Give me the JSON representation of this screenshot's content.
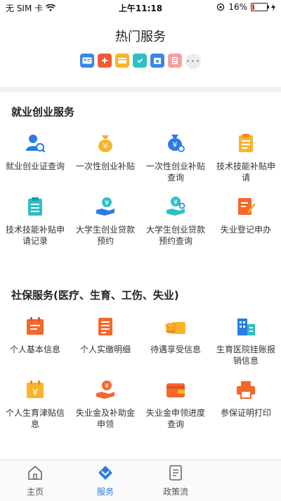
{
  "status_bar": {
    "carrier": "无 SIM 卡",
    "time": "上午11:18",
    "battery": "16%",
    "battery_level": 0.16
  },
  "header": {
    "title": "热门服务"
  },
  "hot_icons": [
    "id-card-icon",
    "medical-kit-icon",
    "wallet-icon",
    "shield-check-icon",
    "calendar-icon",
    "document-icon"
  ],
  "section1": {
    "title": "就业创业服务",
    "items": [
      {
        "label": "就业创业证查询",
        "icon": "user-search-icon"
      },
      {
        "label": "一次性创业补贴",
        "icon": "money-bag-icon"
      },
      {
        "label": "一次性创业补贴查询",
        "icon": "money-bag-search-icon"
      },
      {
        "label": "技术技能补贴申请",
        "icon": "clipboard-icon"
      },
      {
        "label": "技术技能补贴申请记录",
        "icon": "clipboard-list-icon"
      },
      {
        "label": "大学生创业贷款预约",
        "icon": "hand-coin-icon"
      },
      {
        "label": "大学生创业贷款预约查询",
        "icon": "hand-coin-search-icon"
      },
      {
        "label": "失业登记申办",
        "icon": "edit-document-icon"
      }
    ]
  },
  "section2": {
    "title": "社保服务(医疗、生育、工伤、失业)",
    "items": [
      {
        "label": "个人基本信息",
        "icon": "calendar-info-icon"
      },
      {
        "label": "个人实缴明细",
        "icon": "document-list-icon"
      },
      {
        "label": "待遇享受信息",
        "icon": "coins-wallet-icon"
      },
      {
        "label": "生育医院挂账报销信息",
        "icon": "hospital-building-icon"
      },
      {
        "label": "个人生育津贴信息",
        "icon": "allowance-calendar-icon"
      },
      {
        "label": "失业金及补助金申领",
        "icon": "hand-money-icon"
      },
      {
        "label": "失业金申领进度查询",
        "icon": "wallet-progress-icon"
      },
      {
        "label": "参保证明打印",
        "icon": "printer-icon"
      }
    ]
  },
  "tab_bar": {
    "tabs": [
      {
        "label": "主页",
        "icon": "home-icon"
      },
      {
        "label": "服务",
        "icon": "service-icon",
        "active": true
      },
      {
        "label": "政策流",
        "icon": "policy-icon"
      }
    ]
  },
  "colors": {
    "accent": "#2c7be5",
    "orange": "#f5672a",
    "yellow": "#f7b52c",
    "teal": "#2ebfc4"
  }
}
